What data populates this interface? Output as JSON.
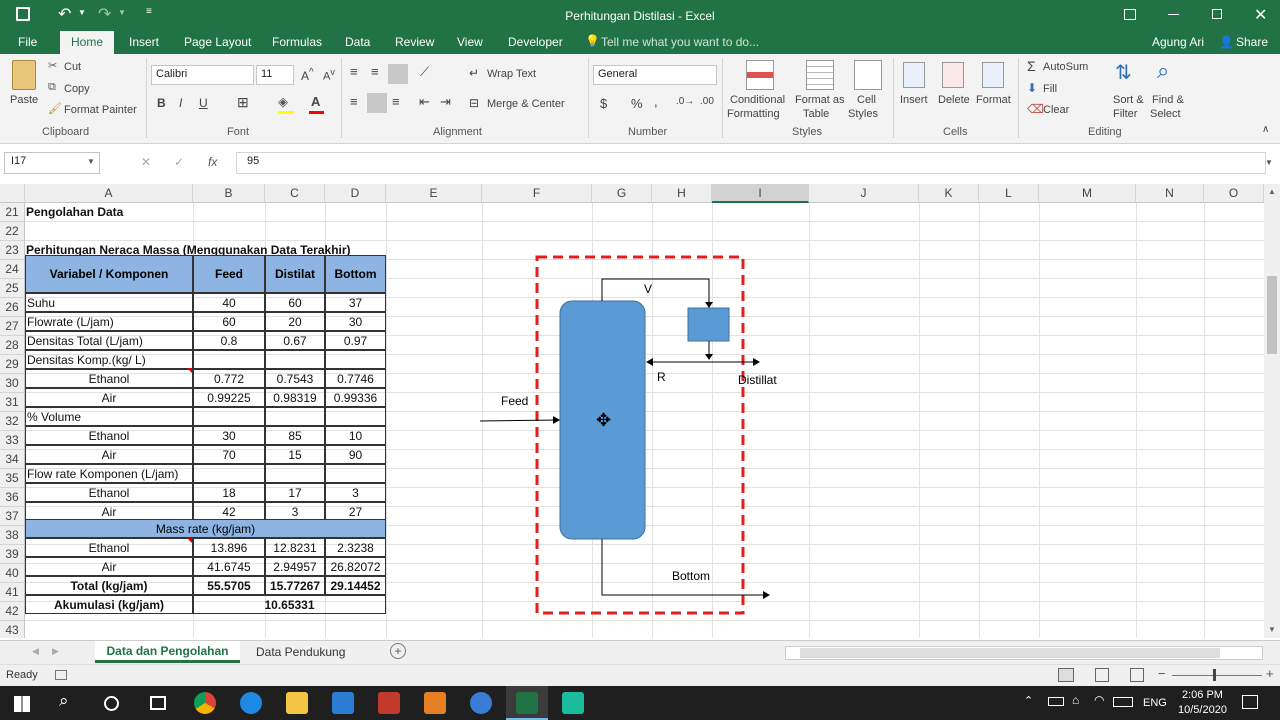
{
  "window": {
    "title": "Perhitungan Distilasi - Excel",
    "user": "Agung Ari",
    "share": "Share"
  },
  "ribbon_tabs": [
    "File",
    "Home",
    "Insert",
    "Page Layout",
    "Formulas",
    "Data",
    "Review",
    "View",
    "Developer"
  ],
  "tell_me": "Tell me what you want to do...",
  "clipboard": {
    "paste": "Paste",
    "cut": "Cut",
    "copy": "Copy",
    "format_painter": "Format Painter",
    "label": "Clipboard"
  },
  "font": {
    "name": "Calibri",
    "size": "11",
    "label": "Font"
  },
  "alignment": {
    "wrap": "Wrap Text",
    "merge": "Merge & Center",
    "label": "Alignment"
  },
  "number": {
    "format": "General",
    "label": "Number"
  },
  "styles": {
    "cond1": "Conditional",
    "cond2": "Formatting",
    "fmt1": "Format as",
    "fmt2": "Table",
    "cell1": "Cell",
    "cell2": "Styles",
    "label": "Styles"
  },
  "cells": {
    "insert": "Insert",
    "delete": "Delete",
    "format": "Format",
    "label": "Cells"
  },
  "editing": {
    "autosum": "AutoSum",
    "fill": "Fill",
    "clear": "Clear",
    "sort1": "Sort &",
    "sort2": "Filter",
    "find1": "Find &",
    "find2": "Select",
    "label": "Editing"
  },
  "formula_bar": {
    "name_box": "I17",
    "fx": "fx",
    "value": "95"
  },
  "columns": [
    "A",
    "B",
    "C",
    "D",
    "E",
    "F",
    "G",
    "H",
    "I",
    "J",
    "K",
    "L",
    "M",
    "N",
    "O"
  ],
  "rows": [
    "21",
    "22",
    "23",
    "24",
    "25",
    "26",
    "27",
    "28",
    "29",
    "30",
    "31",
    "32",
    "33",
    "34",
    "35",
    "36",
    "37",
    "38",
    "39",
    "40",
    "41",
    "42",
    "43"
  ],
  "sheet": {
    "title1": "Pengolahan Data",
    "title2": "Perhitungan Neraca Massa (Menggunakan Data Terakhir)",
    "headers": [
      "Variabel / Komponen",
      "Feed",
      "Distilat",
      "Bottom"
    ],
    "table": [
      [
        "Suhu",
        "40",
        "60",
        "37"
      ],
      [
        "Flowrate (L/jam)",
        "60",
        "20",
        "30"
      ],
      [
        "Densitas Total (L/jam)",
        "0.8",
        "0.67",
        "0.97"
      ],
      [
        "Densitas Komp.(kg/ L)",
        "",
        "",
        ""
      ],
      [
        "Ethanol",
        "0.772",
        "0.7543",
        "0.7746"
      ],
      [
        "Air",
        "0.99225",
        "0.98319",
        "0.99336"
      ],
      [
        "% Volume",
        "",
        "",
        ""
      ],
      [
        "Ethanol",
        "30",
        "85",
        "10"
      ],
      [
        "Air",
        "70",
        "15",
        "90"
      ],
      [
        "Flow rate Komponen (L/jam)",
        "",
        "",
        ""
      ],
      [
        "Ethanol",
        "18",
        "17",
        "3"
      ],
      [
        "Air",
        "42",
        "3",
        "27"
      ]
    ],
    "mass_rate": "Mass rate (kg/jam)",
    "mass": [
      [
        "Ethanol",
        "13.896",
        "12.8231",
        "2.3238"
      ],
      [
        "Air",
        "41.6745",
        "2.94957",
        "26.82072"
      ],
      [
        "Total (kg/jam)",
        "55.5705",
        "15.77267",
        "29.14452"
      ]
    ],
    "akumulasi": [
      "Akumulasi (kg/jam)",
      "10.65331"
    ]
  },
  "diagram": {
    "v": "V",
    "r": "R",
    "distillat": "Distillat",
    "feed": "Feed",
    "bottom": "Bottom"
  },
  "sheet_tabs": [
    "Data dan Pengolahan",
    "Data Pendukung"
  ],
  "status": {
    "ready": "Ready"
  },
  "clock": {
    "time": "2:06 PM",
    "date": "10/5/2020",
    "lang": "ENG"
  },
  "colors": {
    "excel_green": "#217346",
    "header_blue": "#8db4e2",
    "column_blue": "#5b9bd5",
    "dash_red": "#e02020"
  }
}
